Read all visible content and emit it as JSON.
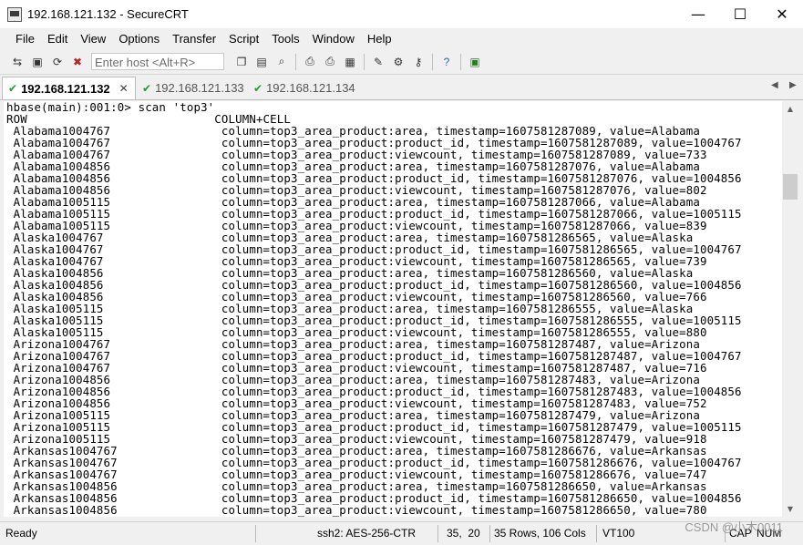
{
  "window": {
    "title": "192.168.121.132 - SecureCRT",
    "minimize": "—",
    "maximize": "☐",
    "close": "✕"
  },
  "menu": [
    "File",
    "Edit",
    "View",
    "Options",
    "Transfer",
    "Script",
    "Tools",
    "Window",
    "Help"
  ],
  "toolbar": {
    "host_placeholder": "Enter host <Alt+R>"
  },
  "tabs": [
    {
      "label": "192.168.121.132",
      "active": true
    },
    {
      "label": "192.168.121.133",
      "active": false
    },
    {
      "label": "192.168.121.134",
      "active": false
    }
  ],
  "terminal": {
    "prompt": "hbase(main):001:0> scan 'top3'",
    "header": "ROW                           COLUMN+CELL",
    "rows": [
      " Alabama1004767                column=top3_area_product:area, timestamp=1607581287089, value=Alabama",
      " Alabama1004767                column=top3_area_product:product_id, timestamp=1607581287089, value=1004767",
      " Alabama1004767                column=top3_area_product:viewcount, timestamp=1607581287089, value=733",
      " Alabama1004856                column=top3_area_product:area, timestamp=1607581287076, value=Alabama",
      " Alabama1004856                column=top3_area_product:product_id, timestamp=1607581287076, value=1004856",
      " Alabama1004856                column=top3_area_product:viewcount, timestamp=1607581287076, value=802",
      " Alabama1005115                column=top3_area_product:area, timestamp=1607581287066, value=Alabama",
      " Alabama1005115                column=top3_area_product:product_id, timestamp=1607581287066, value=1005115",
      " Alabama1005115                column=top3_area_product:viewcount, timestamp=1607581287066, value=839",
      " Alaska1004767                 column=top3_area_product:area, timestamp=1607581286565, value=Alaska",
      " Alaska1004767                 column=top3_area_product:product_id, timestamp=1607581286565, value=1004767",
      " Alaska1004767                 column=top3_area_product:viewcount, timestamp=1607581286565, value=739",
      " Alaska1004856                 column=top3_area_product:area, timestamp=1607581286560, value=Alaska",
      " Alaska1004856                 column=top3_area_product:product_id, timestamp=1607581286560, value=1004856",
      " Alaska1004856                 column=top3_area_product:viewcount, timestamp=1607581286560, value=766",
      " Alaska1005115                 column=top3_area_product:area, timestamp=1607581286555, value=Alaska",
      " Alaska1005115                 column=top3_area_product:product_id, timestamp=1607581286555, value=1005115",
      " Alaska1005115                 column=top3_area_product:viewcount, timestamp=1607581286555, value=880",
      " Arizona1004767                column=top3_area_product:area, timestamp=1607581287487, value=Arizona",
      " Arizona1004767                column=top3_area_product:product_id, timestamp=1607581287487, value=1004767",
      " Arizona1004767                column=top3_area_product:viewcount, timestamp=1607581287487, value=716",
      " Arizona1004856                column=top3_area_product:area, timestamp=1607581287483, value=Arizona",
      " Arizona1004856                column=top3_area_product:product_id, timestamp=1607581287483, value=1004856",
      " Arizona1004856                column=top3_area_product:viewcount, timestamp=1607581287483, value=752",
      " Arizona1005115                column=top3_area_product:area, timestamp=1607581287479, value=Arizona",
      " Arizona1005115                column=top3_area_product:product_id, timestamp=1607581287479, value=1005115",
      " Arizona1005115                column=top3_area_product:viewcount, timestamp=1607581287479, value=918",
      " Arkansas1004767               column=top3_area_product:area, timestamp=1607581286676, value=Arkansas",
      " Arkansas1004767               column=top3_area_product:product_id, timestamp=1607581286676, value=1004767",
      " Arkansas1004767               column=top3_area_product:viewcount, timestamp=1607581286676, value=747",
      " Arkansas1004856               column=top3_area_product:area, timestamp=1607581286650, value=Arkansas",
      " Arkansas1004856               column=top3_area_product:product_id, timestamp=1607581286650, value=1004856",
      " Arkansas1004856               column=top3_area_product:viewcount, timestamp=1607581286650, value=780"
    ]
  },
  "status": {
    "ready": "Ready",
    "encryption": "ssh2: AES-256-CTR",
    "cursor": "35,  20",
    "size": "35 Rows, 106 Cols",
    "terminal_type": "VT100",
    "caps": "CAP",
    "num": "NUM"
  },
  "watermark": "CSDN @小木0011"
}
